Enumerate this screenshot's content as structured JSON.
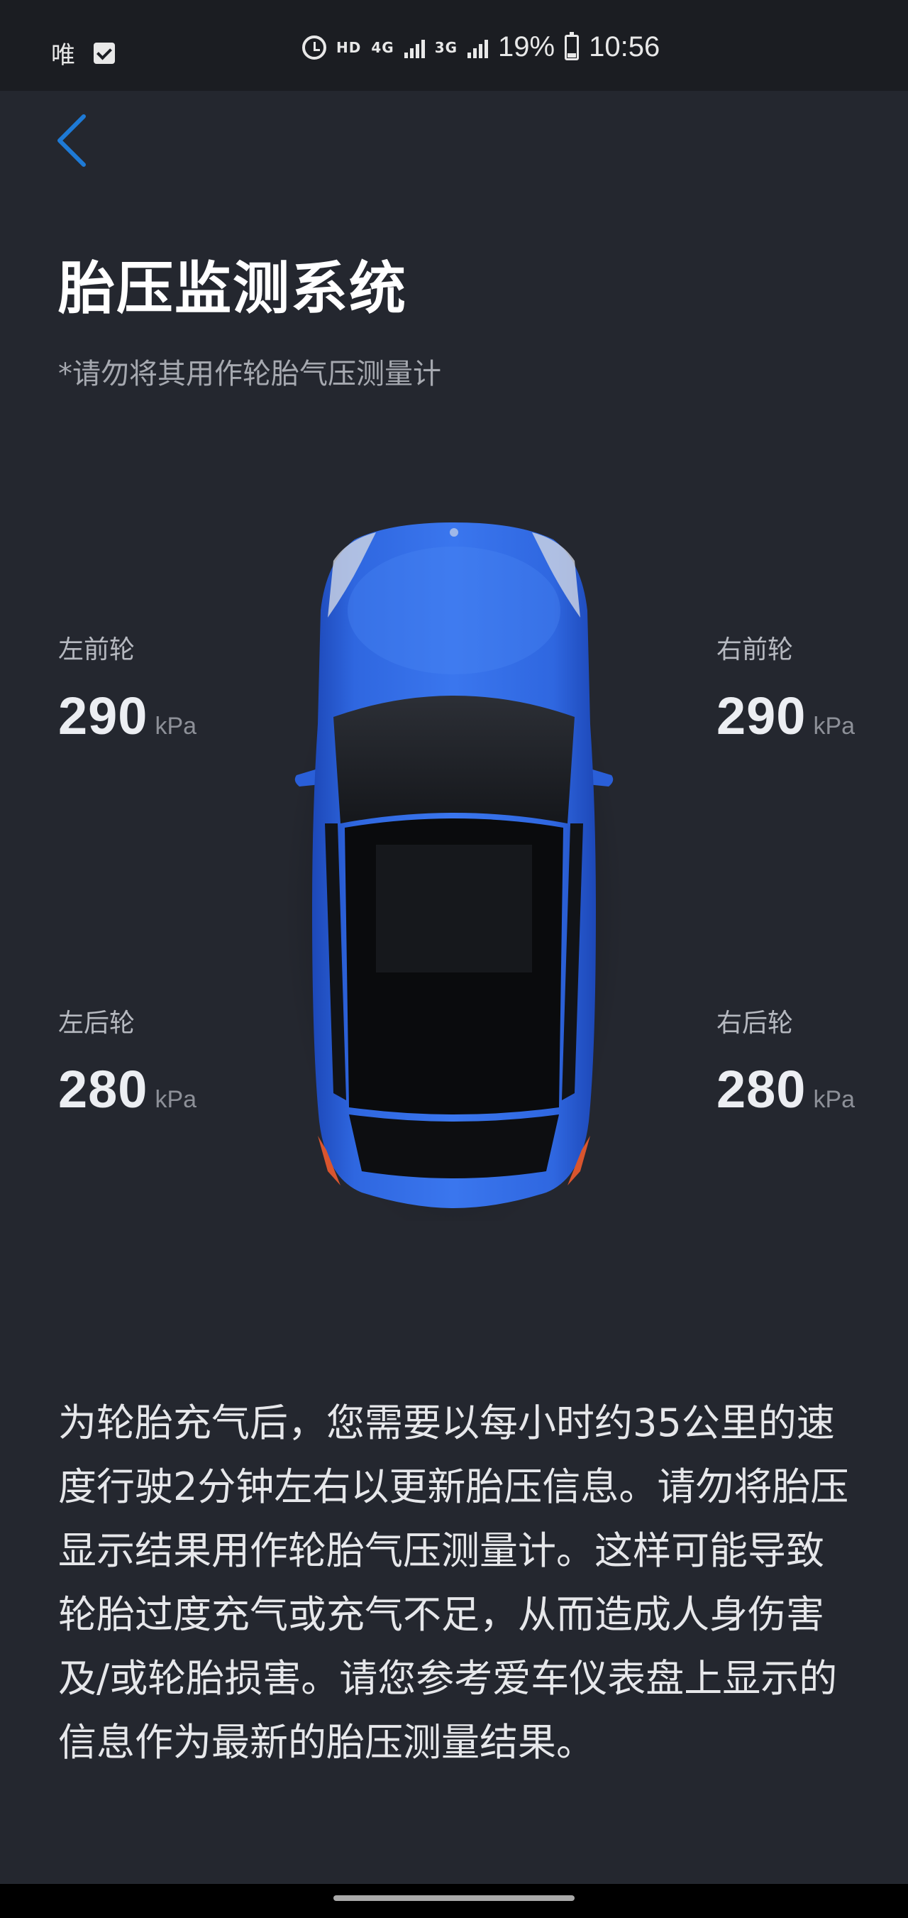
{
  "status_bar": {
    "carrier": "唯",
    "hd": "HD",
    "network1": "4G",
    "network2": "3G",
    "battery": "19%",
    "time": "10:56"
  },
  "header": {
    "title": "胎压监测系统",
    "subtitle": "*请勿将其用作轮胎气压测量计"
  },
  "tires": {
    "front_left": {
      "label": "左前轮",
      "value": "290",
      "unit": "kPa"
    },
    "front_right": {
      "label": "右前轮",
      "value": "290",
      "unit": "kPa"
    },
    "rear_left": {
      "label": "左后轮",
      "value": "280",
      "unit": "kPa"
    },
    "rear_right": {
      "label": "右后轮",
      "value": "280",
      "unit": "kPa"
    }
  },
  "description": "为轮胎充气后，您需要以每小时约35公里的速度行驶2分钟左右以更新胎压信息。请勿将胎压显示结果用作轮胎气压测量计。这样可能导致轮胎过度充气或充气不足，从而造成人身伤害及/或轮胎损害。请您参考爱车仪表盘上显示的信息作为最新的胎压测量结果。",
  "colors": {
    "background": "#24272f",
    "accent": "#1e7ad6",
    "car_body": "#2a5fd8"
  }
}
